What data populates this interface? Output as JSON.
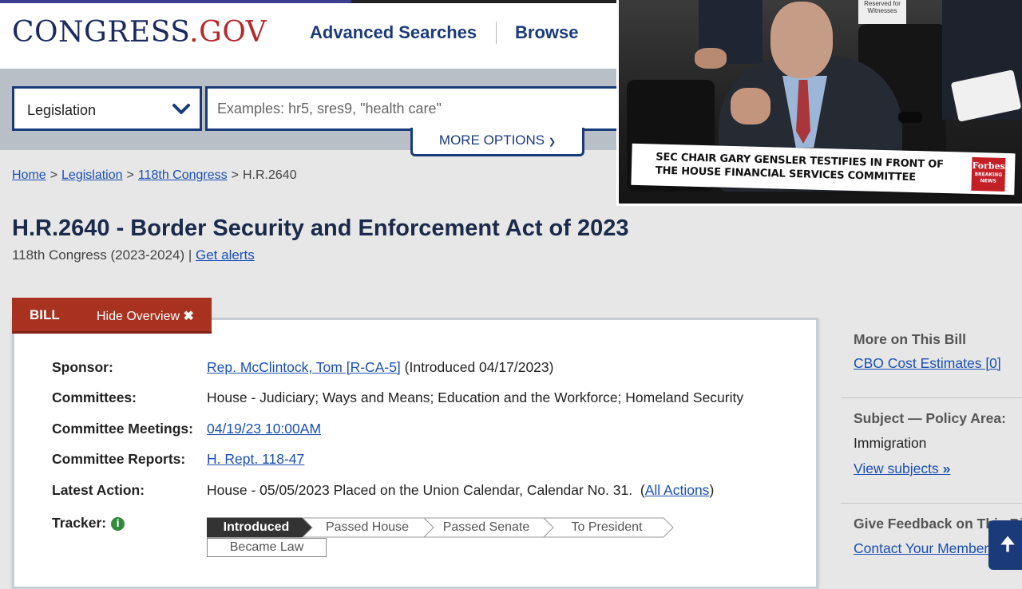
{
  "header": {
    "logo_main": "CONGRESS",
    "logo_dot": ".",
    "logo_gov": "GOV",
    "nav_advanced": "Advanced Searches",
    "nav_browse": "Browse"
  },
  "search": {
    "collection_selected": "Legislation",
    "placeholder": "Examples: hr5, sres9, \"health care\"",
    "more_options": "MORE OPTIONS"
  },
  "breadcrumb": [
    {
      "label": "Home",
      "link": true
    },
    {
      "label": "Legislation",
      "link": true
    },
    {
      "label": "118th Congress",
      "link": true
    },
    {
      "label": "H.R.2640",
      "link": false
    }
  ],
  "bill": {
    "title": "H.R.2640 - Border Security and Enforcement Act of 2023",
    "congress": "118th Congress (2023-2024)",
    "separator": "|",
    "get_alerts": "Get alerts",
    "tab_label": "BILL",
    "hide_overview": "Hide Overview"
  },
  "overview": {
    "sponsor_label": "Sponsor:",
    "sponsor_link": "Rep. McClintock, Tom [R-CA-5]",
    "sponsor_note": "(Introduced 04/17/2023)",
    "committees_label": "Committees:",
    "committees_value": "House - Judiciary; Ways and Means; Education and the Workforce; Homeland Security",
    "meetings_label": "Committee Meetings:",
    "meetings_link": "04/19/23 10:00AM",
    "reports_label": "Committee Reports:",
    "reports_link": "H. Rept. 118-47",
    "latest_label": "Latest Action:",
    "latest_value": "House - 05/05/2023 Placed on the Union Calendar, Calendar No. 31.",
    "all_actions": "All Actions",
    "tracker_label": "Tracker:",
    "tracker_steps": [
      "Introduced",
      "Passed House",
      "Passed Senate",
      "To President"
    ],
    "tracker_final": "Became Law",
    "tracker_current_index": 0
  },
  "sidebar": {
    "more_head": "More on This Bill",
    "cbo_link": "CBO Cost Estimates [0]",
    "subject_head": "Subject — Policy Area:",
    "subject_value": "Immigration",
    "view_subjects": "View subjects",
    "feedback_head": "Give Feedback on This Bill",
    "contact_link": "Contact Your Member"
  },
  "video": {
    "caption": "SEC CHAIR GARY GENSLER TESTIFIES IN FRONT OF THE HOUSE FINANCIAL SERVICES COMMITTEE",
    "brand": "Forbes",
    "brand_sub": "BREAKING NEWS",
    "nameplate": "Reserved for Witnesses"
  },
  "colors": {
    "brand_navy": "#1b3a7a",
    "bill_red": "#a8321f",
    "link_blue": "#1a4fb5",
    "info_green": "#2e8b3a"
  }
}
